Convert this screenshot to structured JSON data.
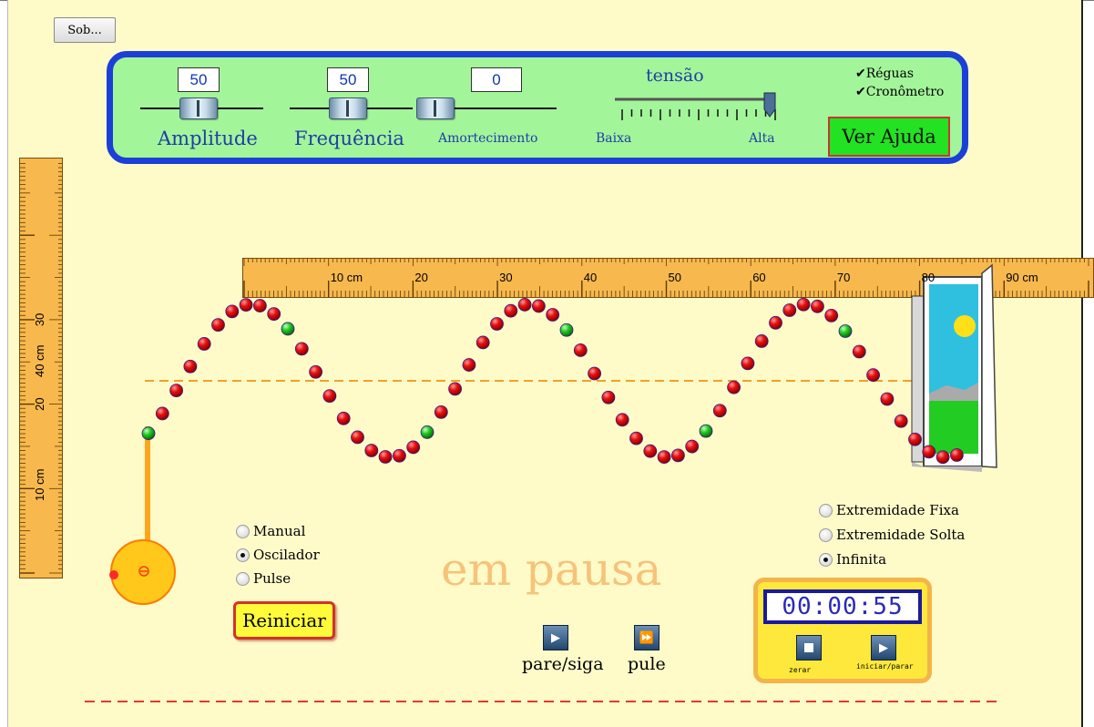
{
  "window": {
    "about_button": "Sob..."
  },
  "controls": {
    "amplitude": {
      "label": "Amplitude",
      "value": "50"
    },
    "frequency": {
      "label": "Frequência",
      "value": "50"
    },
    "damping": {
      "label": "Amortecimento",
      "value": "0"
    },
    "tension": {
      "label": "tensão",
      "low": "Baixa",
      "high": "Alta",
      "level": 1.0
    },
    "rulers_check": "Réguas",
    "stopwatch_check": "Cronômetro",
    "help_button": "Ver Ajuda"
  },
  "rulers": {
    "horizontal_labels": [
      "10 cm",
      "20",
      "30",
      "40",
      "50",
      "60",
      "70",
      "80",
      "90 cm"
    ],
    "vertical_labels": [
      "40 cm",
      "30",
      "20",
      "10 cm"
    ]
  },
  "drive_mode": {
    "options": [
      "Manual",
      "Oscilador",
      "Pulse"
    ],
    "selected": "Oscilador"
  },
  "end_mode": {
    "options": [
      "Extremidade Fixa",
      "Extremidade Solta",
      "Infinita"
    ],
    "selected": "Infinita"
  },
  "reset_button": "Reiniciar",
  "status_text": "em pausa",
  "playback": {
    "pause_play": "pare/siga",
    "step": "pule"
  },
  "stopwatch": {
    "time": "00:00:55",
    "reset": "zerar",
    "start_stop": "iniciar/parar"
  },
  "colors": {
    "background": "#fffbc9",
    "panel": "#a3f59a",
    "panel_border": "#1c3fd8",
    "bead": "#e01010",
    "marker_bead": "#22cc22"
  }
}
